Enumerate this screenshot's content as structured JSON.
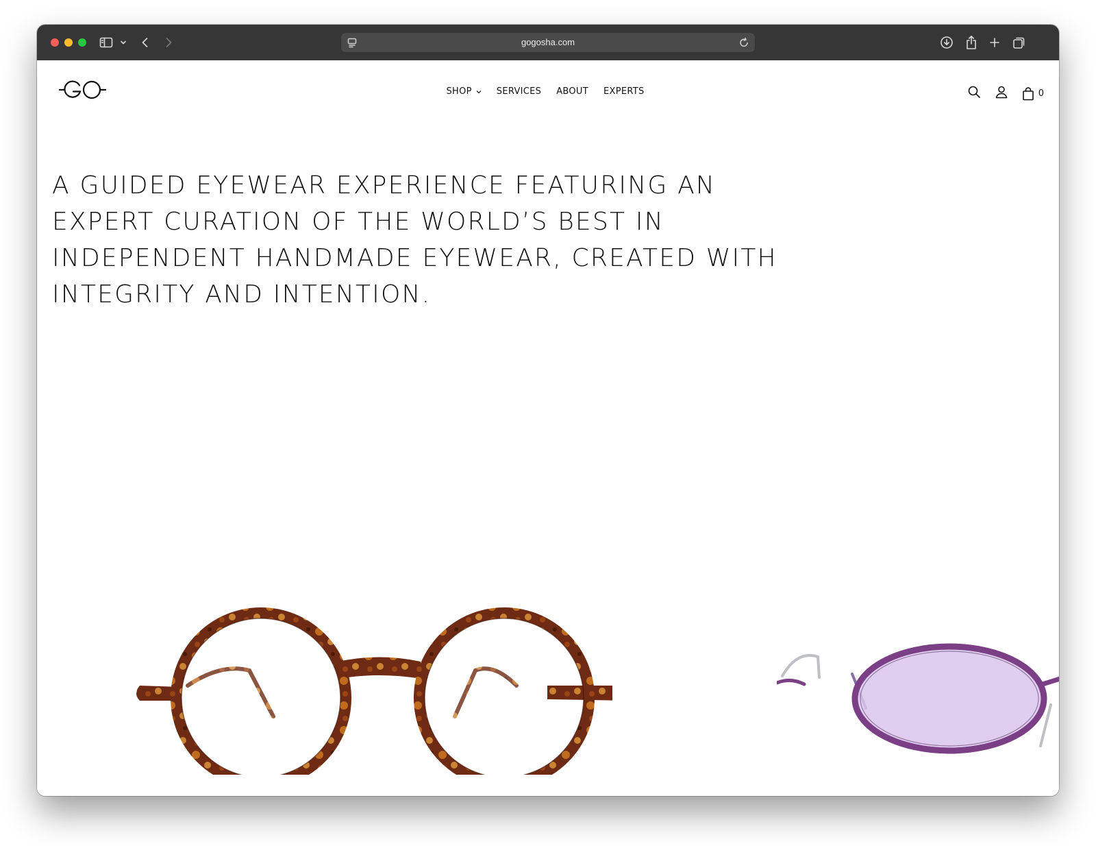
{
  "browser": {
    "url": "gogosha.com",
    "icons": [
      "sidebar-icon",
      "chevron-down-icon",
      "back-icon",
      "forward-icon",
      "site-settings-icon",
      "reload-icon",
      "download-icon",
      "share-icon",
      "new-tab-icon",
      "tab-overview-icon"
    ]
  },
  "site": {
    "logo_text": "GO",
    "nav": [
      {
        "label": "SHOP",
        "has_dropdown": true
      },
      {
        "label": "SERVICES"
      },
      {
        "label": "ABOUT"
      },
      {
        "label": "EXPERTS"
      }
    ],
    "cart_count": "0",
    "utility_icons": [
      "search-icon",
      "account-icon",
      "cart-icon"
    ]
  },
  "hero": {
    "text": "A GUIDED EYEWEAR EXPERIENCE FEATURING AN EXPERT CURATION OF THE WORLD’S BEST IN INDEPENDENT HANDMADE EYEWEAR, CREATED WITH INTEGRITY AND INTENTION."
  },
  "products": [
    {
      "description_icon": "round-tortoise-glasses",
      "frame_color": "#7a2e14",
      "accent_color": "#d88a2c"
    },
    {
      "description_icon": "oval-purple-sunglasses",
      "frame_color": "#7b3f86",
      "lens_color": "#d9c5ec"
    }
  ]
}
